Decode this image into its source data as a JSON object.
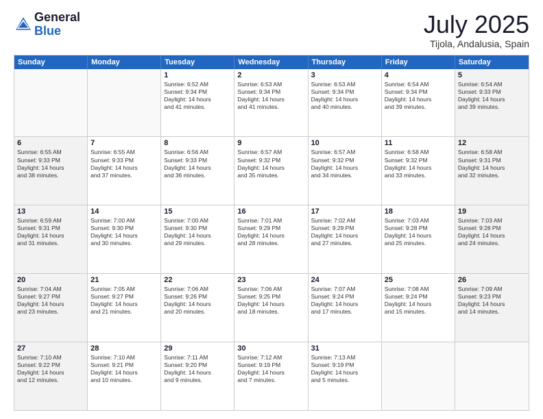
{
  "header": {
    "logo_general": "General",
    "logo_blue": "Blue",
    "month": "July 2025",
    "location": "Tijola, Andalusia, Spain"
  },
  "weekdays": [
    "Sunday",
    "Monday",
    "Tuesday",
    "Wednesday",
    "Thursday",
    "Friday",
    "Saturday"
  ],
  "rows": [
    [
      {
        "day": "",
        "empty": true
      },
      {
        "day": "",
        "empty": true
      },
      {
        "day": "1",
        "l1": "Sunrise: 6:52 AM",
        "l2": "Sunset: 9:34 PM",
        "l3": "Daylight: 14 hours",
        "l4": "and 41 minutes."
      },
      {
        "day": "2",
        "l1": "Sunrise: 6:53 AM",
        "l2": "Sunset: 9:34 PM",
        "l3": "Daylight: 14 hours",
        "l4": "and 41 minutes."
      },
      {
        "day": "3",
        "l1": "Sunrise: 6:53 AM",
        "l2": "Sunset: 9:34 PM",
        "l3": "Daylight: 14 hours",
        "l4": "and 40 minutes."
      },
      {
        "day": "4",
        "l1": "Sunrise: 6:54 AM",
        "l2": "Sunset: 9:34 PM",
        "l3": "Daylight: 14 hours",
        "l4": "and 39 minutes."
      },
      {
        "day": "5",
        "l1": "Sunrise: 6:54 AM",
        "l2": "Sunset: 9:33 PM",
        "l3": "Daylight: 14 hours",
        "l4": "and 39 minutes.",
        "shaded": true
      }
    ],
    [
      {
        "day": "6",
        "l1": "Sunrise: 6:55 AM",
        "l2": "Sunset: 9:33 PM",
        "l3": "Daylight: 14 hours",
        "l4": "and 38 minutes.",
        "shaded": true
      },
      {
        "day": "7",
        "l1": "Sunrise: 6:55 AM",
        "l2": "Sunset: 9:33 PM",
        "l3": "Daylight: 14 hours",
        "l4": "and 37 minutes."
      },
      {
        "day": "8",
        "l1": "Sunrise: 6:56 AM",
        "l2": "Sunset: 9:33 PM",
        "l3": "Daylight: 14 hours",
        "l4": "and 36 minutes."
      },
      {
        "day": "9",
        "l1": "Sunrise: 6:57 AM",
        "l2": "Sunset: 9:32 PM",
        "l3": "Daylight: 14 hours",
        "l4": "and 35 minutes."
      },
      {
        "day": "10",
        "l1": "Sunrise: 6:57 AM",
        "l2": "Sunset: 9:32 PM",
        "l3": "Daylight: 14 hours",
        "l4": "and 34 minutes."
      },
      {
        "day": "11",
        "l1": "Sunrise: 6:58 AM",
        "l2": "Sunset: 9:32 PM",
        "l3": "Daylight: 14 hours",
        "l4": "and 33 minutes."
      },
      {
        "day": "12",
        "l1": "Sunrise: 6:58 AM",
        "l2": "Sunset: 9:31 PM",
        "l3": "Daylight: 14 hours",
        "l4": "and 32 minutes.",
        "shaded": true
      }
    ],
    [
      {
        "day": "13",
        "l1": "Sunrise: 6:59 AM",
        "l2": "Sunset: 9:31 PM",
        "l3": "Daylight: 14 hours",
        "l4": "and 31 minutes.",
        "shaded": true
      },
      {
        "day": "14",
        "l1": "Sunrise: 7:00 AM",
        "l2": "Sunset: 9:30 PM",
        "l3": "Daylight: 14 hours",
        "l4": "and 30 minutes."
      },
      {
        "day": "15",
        "l1": "Sunrise: 7:00 AM",
        "l2": "Sunset: 9:30 PM",
        "l3": "Daylight: 14 hours",
        "l4": "and 29 minutes."
      },
      {
        "day": "16",
        "l1": "Sunrise: 7:01 AM",
        "l2": "Sunset: 9:29 PM",
        "l3": "Daylight: 14 hours",
        "l4": "and 28 minutes."
      },
      {
        "day": "17",
        "l1": "Sunrise: 7:02 AM",
        "l2": "Sunset: 9:29 PM",
        "l3": "Daylight: 14 hours",
        "l4": "and 27 minutes."
      },
      {
        "day": "18",
        "l1": "Sunrise: 7:03 AM",
        "l2": "Sunset: 9:28 PM",
        "l3": "Daylight: 14 hours",
        "l4": "and 25 minutes."
      },
      {
        "day": "19",
        "l1": "Sunrise: 7:03 AM",
        "l2": "Sunset: 9:28 PM",
        "l3": "Daylight: 14 hours",
        "l4": "and 24 minutes.",
        "shaded": true
      }
    ],
    [
      {
        "day": "20",
        "l1": "Sunrise: 7:04 AM",
        "l2": "Sunset: 9:27 PM",
        "l3": "Daylight: 14 hours",
        "l4": "and 23 minutes.",
        "shaded": true
      },
      {
        "day": "21",
        "l1": "Sunrise: 7:05 AM",
        "l2": "Sunset: 9:27 PM",
        "l3": "Daylight: 14 hours",
        "l4": "and 21 minutes."
      },
      {
        "day": "22",
        "l1": "Sunrise: 7:06 AM",
        "l2": "Sunset: 9:26 PM",
        "l3": "Daylight: 14 hours",
        "l4": "and 20 minutes."
      },
      {
        "day": "23",
        "l1": "Sunrise: 7:06 AM",
        "l2": "Sunset: 9:25 PM",
        "l3": "Daylight: 14 hours",
        "l4": "and 18 minutes."
      },
      {
        "day": "24",
        "l1": "Sunrise: 7:07 AM",
        "l2": "Sunset: 9:24 PM",
        "l3": "Daylight: 14 hours",
        "l4": "and 17 minutes."
      },
      {
        "day": "25",
        "l1": "Sunrise: 7:08 AM",
        "l2": "Sunset: 9:24 PM",
        "l3": "Daylight: 14 hours",
        "l4": "and 15 minutes."
      },
      {
        "day": "26",
        "l1": "Sunrise: 7:09 AM",
        "l2": "Sunset: 9:23 PM",
        "l3": "Daylight: 14 hours",
        "l4": "and 14 minutes.",
        "shaded": true
      }
    ],
    [
      {
        "day": "27",
        "l1": "Sunrise: 7:10 AM",
        "l2": "Sunset: 9:22 PM",
        "l3": "Daylight: 14 hours",
        "l4": "and 12 minutes.",
        "shaded": true
      },
      {
        "day": "28",
        "l1": "Sunrise: 7:10 AM",
        "l2": "Sunset: 9:21 PM",
        "l3": "Daylight: 14 hours",
        "l4": "and 10 minutes."
      },
      {
        "day": "29",
        "l1": "Sunrise: 7:11 AM",
        "l2": "Sunset: 9:20 PM",
        "l3": "Daylight: 14 hours",
        "l4": "and 9 minutes."
      },
      {
        "day": "30",
        "l1": "Sunrise: 7:12 AM",
        "l2": "Sunset: 9:19 PM",
        "l3": "Daylight: 14 hours",
        "l4": "and 7 minutes."
      },
      {
        "day": "31",
        "l1": "Sunrise: 7:13 AM",
        "l2": "Sunset: 9:19 PM",
        "l3": "Daylight: 14 hours",
        "l4": "and 5 minutes."
      },
      {
        "day": "",
        "empty": true
      },
      {
        "day": "",
        "empty": true,
        "shaded": true
      }
    ]
  ]
}
